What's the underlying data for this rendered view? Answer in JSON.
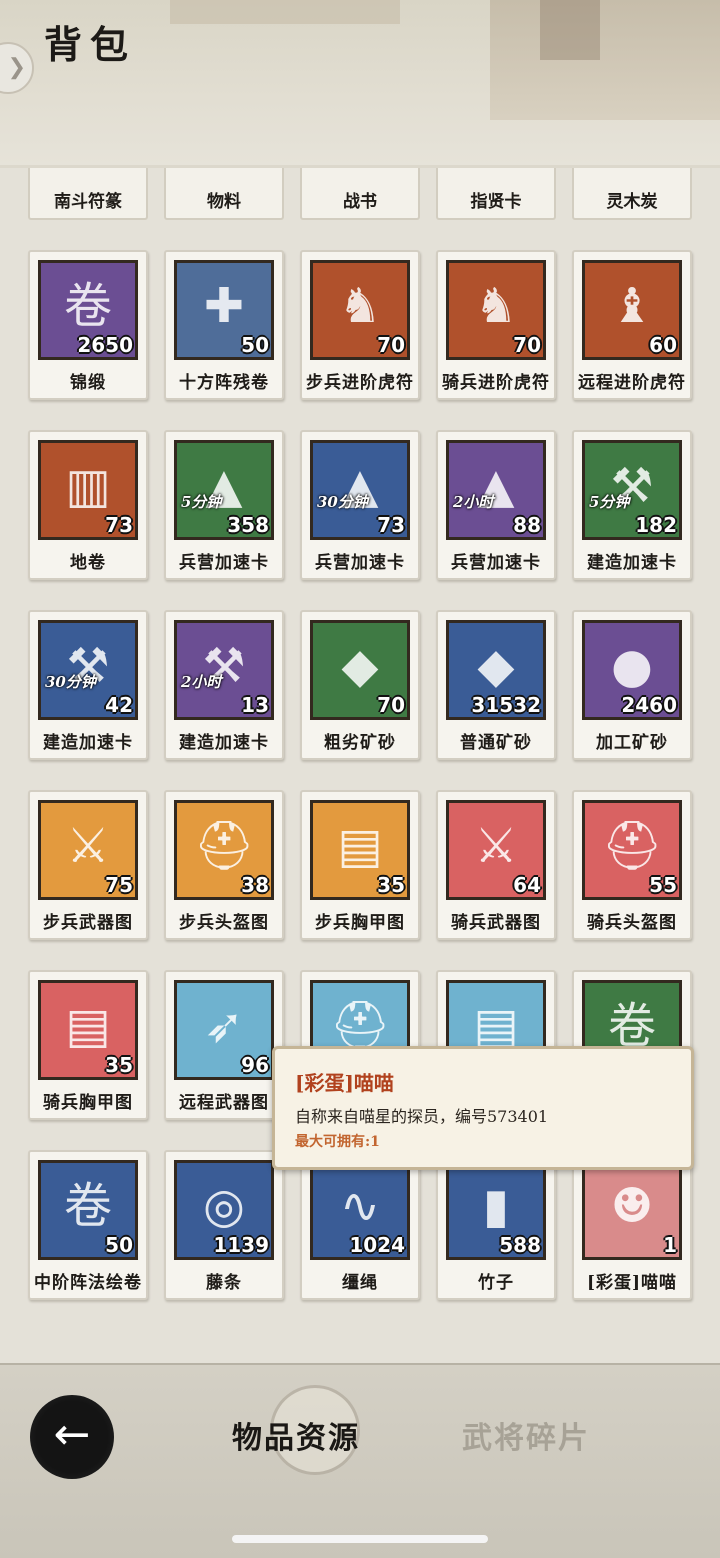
{
  "header": {
    "title": "背包"
  },
  "top_row": [
    "南斗符篆",
    "物料",
    "战书",
    "指贤卡",
    "灵木炭"
  ],
  "rows": [
    [
      {
        "name": "锦缎",
        "count": "2650",
        "icon": "silk-scroll-icon",
        "bg": "#6b4e93",
        "glyph": "卷"
      },
      {
        "name": "十方阵残卷",
        "count": "50",
        "icon": "cross-scroll-icon",
        "bg": "#4f6d99",
        "glyph": "✚"
      },
      {
        "name": "步兵进阶虎符",
        "count": "70",
        "icon": "beast-statue-icon",
        "bg": "#b0512c",
        "glyph": "♞"
      },
      {
        "name": "骑兵进阶虎符",
        "count": "70",
        "icon": "tiger-statue-icon",
        "bg": "#b0512c",
        "glyph": "♞"
      },
      {
        "name": "远程进阶虎符",
        "count": "60",
        "icon": "eagle-statue-icon",
        "bg": "#b0512c",
        "glyph": "♝"
      }
    ],
    [
      {
        "name": "地卷",
        "count": "73",
        "icon": "bamboo-scroll-icon",
        "bg": "#b0512c",
        "glyph": "▥"
      },
      {
        "name": "兵营加速卡",
        "count": "358",
        "icon": "barracks-card-icon",
        "bg": "#3f7a44",
        "glyph": "▲",
        "badge": "5分钟"
      },
      {
        "name": "兵营加速卡",
        "count": "73",
        "icon": "barracks-card-icon",
        "bg": "#3a5c96",
        "glyph": "▲",
        "badge": "30分钟"
      },
      {
        "name": "兵营加速卡",
        "count": "88",
        "icon": "barracks-card-icon",
        "bg": "#6b4e93",
        "glyph": "▲",
        "badge": "2小时"
      },
      {
        "name": "建造加速卡",
        "count": "182",
        "icon": "hammer-medal-icon",
        "bg": "#3f7a44",
        "glyph": "⚒",
        "badge": "5分钟"
      }
    ],
    [
      {
        "name": "建造加速卡",
        "count": "42",
        "icon": "hammer-medal-icon",
        "bg": "#3a5c96",
        "glyph": "⚒",
        "badge": "30分钟"
      },
      {
        "name": "建造加速卡",
        "count": "13",
        "icon": "hammer-medal-icon",
        "bg": "#6b4e93",
        "glyph": "⚒",
        "badge": "2小时"
      },
      {
        "name": "粗劣矿砂",
        "count": "70",
        "icon": "grey-ore-icon",
        "bg": "#3f7a44",
        "glyph": "◆"
      },
      {
        "name": "普通矿砂",
        "count": "31532",
        "icon": "blue-ore-icon",
        "bg": "#3a5c96",
        "glyph": "◆"
      },
      {
        "name": "加工矿砂",
        "count": "2460",
        "icon": "red-ore-icon",
        "bg": "#6b4e93",
        "glyph": "●"
      }
    ],
    [
      {
        "name": "步兵武器图",
        "count": "75",
        "icon": "weapon-blueprint-icon",
        "bg": "#e39a3e",
        "glyph": "⚔"
      },
      {
        "name": "步兵头盔图",
        "count": "38",
        "icon": "helmet-blueprint-icon",
        "bg": "#e39a3e",
        "glyph": "⛑"
      },
      {
        "name": "步兵胸甲图",
        "count": "35",
        "icon": "armor-blueprint-icon",
        "bg": "#e39a3e",
        "glyph": "▤"
      },
      {
        "name": "骑兵武器图",
        "count": "64",
        "icon": "sword-blueprint-icon",
        "bg": "#d96262",
        "glyph": "⚔"
      },
      {
        "name": "骑兵头盔图",
        "count": "55",
        "icon": "helmet-blueprint-icon",
        "bg": "#d96262",
        "glyph": "⛑"
      }
    ],
    [
      {
        "name": "骑兵胸甲图",
        "count": "35",
        "icon": "armor-blueprint-icon",
        "bg": "#d96262",
        "glyph": "▤"
      },
      {
        "name": "远程武器图",
        "count": "96",
        "icon": "bow-blueprint-icon",
        "bg": "#6fb2cf",
        "glyph": "➶"
      },
      {
        "name": "",
        "count": "",
        "icon": "helmet-blueprint-icon",
        "bg": "#6fb2cf",
        "glyph": "⛑"
      },
      {
        "name": "",
        "count": "",
        "icon": "armor-blueprint-icon",
        "bg": "#6fb2cf",
        "glyph": "▤"
      },
      {
        "name": "",
        "count": "",
        "icon": "green-scroll-icon",
        "bg": "#3f7a44",
        "glyph": "卷"
      }
    ],
    [
      {
        "name": "中阶阵法绘卷",
        "count": "50",
        "icon": "blue-scroll-icon",
        "bg": "#3a5c96",
        "glyph": "卷"
      },
      {
        "name": "藤条",
        "count": "1139",
        "icon": "vine-coil-icon",
        "bg": "#3a5c96",
        "glyph": "◎"
      },
      {
        "name": "缰绳",
        "count": "1024",
        "icon": "rein-icon",
        "bg": "#3a5c96",
        "glyph": "∿"
      },
      {
        "name": "竹子",
        "count": "588",
        "icon": "bamboo-icon",
        "bg": "#3a5c96",
        "glyph": "▮"
      },
      {
        "name": "[彩蛋]喵喵",
        "count": "1",
        "icon": "cat-portrait-icon",
        "bg": "#d98b8b",
        "glyph": "☻"
      }
    ]
  ],
  "tooltip": {
    "title": "[彩蛋]喵喵",
    "description": "自称来自喵星的探员，编号573401",
    "limit": "最大可拥有:1"
  },
  "footer": {
    "tab_active": "物品资源",
    "tab_inactive": "武将碎片"
  }
}
